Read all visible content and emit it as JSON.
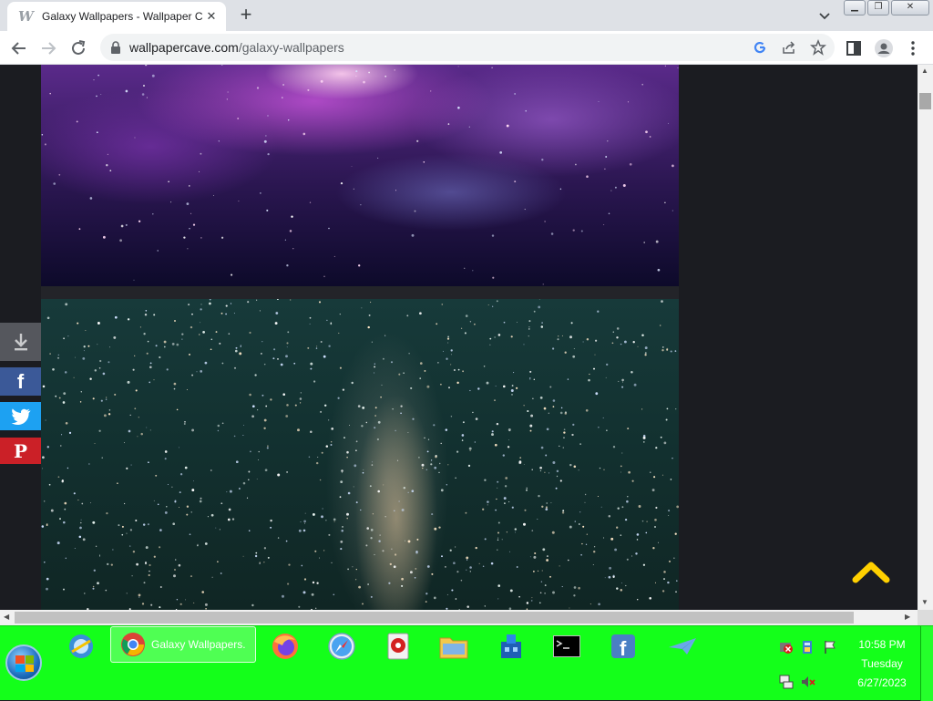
{
  "browser": {
    "tab_title": "Galaxy Wallpapers - Wallpaper C",
    "tab_favicon": "W",
    "close_tab_glyph": "✕",
    "new_tab_glyph": "+",
    "url_host": "wallpapercave.com",
    "url_path": "/galaxy-wallpapers",
    "window_buttons": {
      "minimize": "▁",
      "restore": "❐",
      "close": "✕"
    }
  },
  "page": {
    "share_colors": {
      "download": "#55575d",
      "facebook": "#3b5998",
      "twitter": "#1da1f2",
      "pinterest": "#cb2027"
    },
    "share_glyphs": {
      "facebook": "f",
      "pinterest": "P"
    },
    "accent": "#ffd000"
  },
  "taskbar": {
    "chrome_label": "Galaxy Wallpapers...",
    "clock": {
      "time": "10:58 PM",
      "day": "Tuesday",
      "date": "6/27/2023"
    },
    "background": "#14ff1a"
  }
}
